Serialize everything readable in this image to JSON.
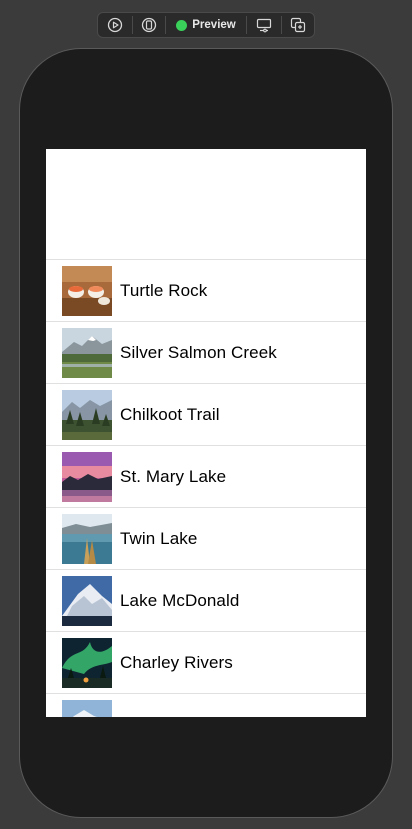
{
  "toolbar": {
    "buttons": [
      {
        "icon": "play-circle-icon"
      },
      {
        "icon": "device-icon"
      },
      {
        "icon": "preview-status-dot-icon",
        "label": "Preview",
        "status_color": "#3ad15a"
      },
      {
        "icon": "device-settings-icon"
      },
      {
        "icon": "duplicate-icon"
      }
    ]
  },
  "landmarks": [
    {
      "name": "Turtle Rock",
      "thumbnail": "sushi-photo"
    },
    {
      "name": "Silver Salmon Creek",
      "thumbnail": "mountain-meadow-photo"
    },
    {
      "name": "Chilkoot Trail",
      "thumbnail": "forest-mountain-photo"
    },
    {
      "name": "St. Mary Lake",
      "thumbnail": "pink-sunset-lake-photo"
    },
    {
      "name": "Twin Lake",
      "thumbnail": "lake-kayak-photo"
    },
    {
      "name": "Lake McDonald",
      "thumbnail": "snowy-mountain-photo"
    },
    {
      "name": "Charley Rivers",
      "thumbnail": "aurora-photo"
    },
    {
      "name": "",
      "thumbnail": "snowy-peak-photo"
    }
  ],
  "colors": {
    "background": "#3b3b3b",
    "device_frame": "#1c1c1c",
    "screen": "#ffffff",
    "separator": "#e0e0e0"
  }
}
